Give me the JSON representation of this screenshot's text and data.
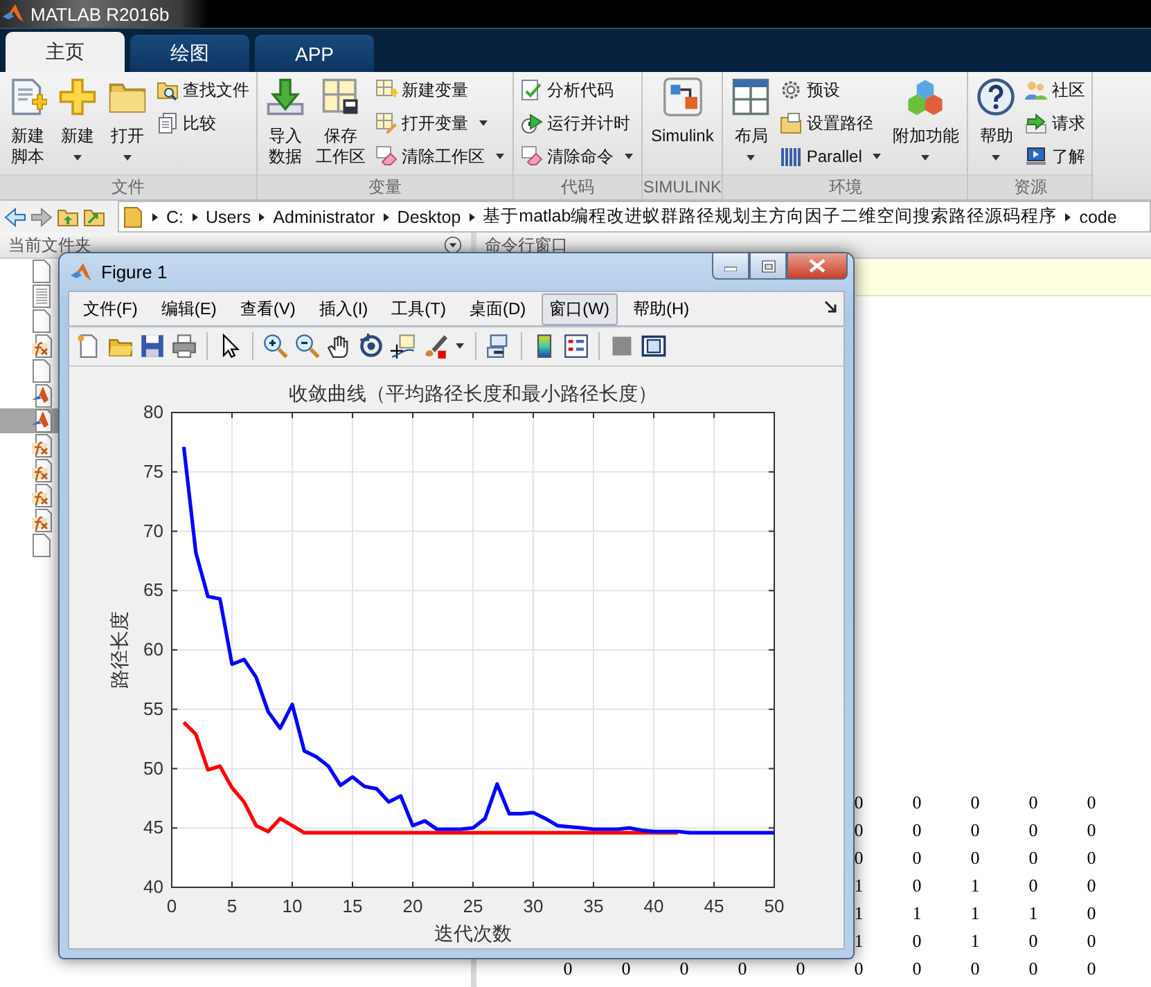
{
  "app_title": "MATLAB R2016b",
  "tabs": [
    {
      "label": "主页",
      "selected": true
    },
    {
      "label": "绘图",
      "selected": false
    },
    {
      "label": "APP",
      "selected": false
    }
  ],
  "toolstrip": {
    "sections": [
      {
        "label": "文件",
        "items": [
          {
            "kind": "big",
            "lines": [
              "新建",
              "脚本"
            ],
            "dropdown": false
          },
          {
            "kind": "big",
            "lines": [
              "新建"
            ],
            "dropdown": true
          },
          {
            "kind": "big",
            "lines": [
              "打开"
            ],
            "dropdown": true
          },
          {
            "kind": "small",
            "label": "查找文件",
            "dropdown": false
          },
          {
            "kind": "small",
            "label": "比较",
            "dropdown": false
          }
        ]
      },
      {
        "label": "变量",
        "items": [
          {
            "kind": "big",
            "lines": [
              "导入",
              "数据"
            ],
            "dropdown": false
          },
          {
            "kind": "big",
            "lines": [
              "保存",
              "工作区"
            ],
            "dropdown": false
          },
          {
            "kind": "small",
            "label": "新建变量",
            "dropdown": false
          },
          {
            "kind": "small",
            "label": "打开变量",
            "dropdown": true
          },
          {
            "kind": "small",
            "label": "清除工作区",
            "dropdown": true
          }
        ]
      },
      {
        "label": "代码",
        "items": [
          {
            "kind": "small",
            "label": "分析代码",
            "dropdown": false
          },
          {
            "kind": "small",
            "label": "运行并计时",
            "dropdown": false
          },
          {
            "kind": "small",
            "label": "清除命令",
            "dropdown": true
          }
        ]
      },
      {
        "label": "SIMULINK",
        "items": [
          {
            "kind": "big",
            "lines": [
              "Simulink"
            ],
            "dropdown": false
          }
        ]
      },
      {
        "label": "环境",
        "items": [
          {
            "kind": "big",
            "lines": [
              "布局"
            ],
            "dropdown": true
          },
          {
            "kind": "small",
            "label": "预设",
            "dropdown": false
          },
          {
            "kind": "small",
            "label": "设置路径",
            "dropdown": false
          },
          {
            "kind": "small",
            "label": "Parallel",
            "dropdown": true
          },
          {
            "kind": "big",
            "lines": [
              "附加功能"
            ],
            "dropdown": true
          }
        ]
      },
      {
        "label": "资源",
        "items": [
          {
            "kind": "big",
            "lines": [
              "帮助"
            ],
            "dropdown": true
          },
          {
            "kind": "small",
            "label": "社区",
            "dropdown": false
          },
          {
            "kind": "small",
            "label": "请求",
            "dropdown": false
          },
          {
            "kind": "small",
            "label": "了解",
            "dropdown": false
          }
        ]
      }
    ]
  },
  "address": {
    "segments": [
      "C:",
      "Users",
      "Administrator",
      "Desktop",
      "基于matlab编程改进蚁群路径规划主方向因子二维空间搜索路径源码程序",
      "code"
    ]
  },
  "files_panel": {
    "title": "当前文件夹",
    "files": [
      {
        "kind": "blank",
        "selected": false
      },
      {
        "kind": "text",
        "selected": false
      },
      {
        "kind": "blank",
        "selected": false
      },
      {
        "kind": "function",
        "selected": false
      },
      {
        "kind": "blank",
        "selected": false
      },
      {
        "kind": "app",
        "selected": false
      },
      {
        "kind": "app",
        "selected": true
      },
      {
        "kind": "function",
        "selected": false
      },
      {
        "kind": "function",
        "selected": false
      },
      {
        "kind": "function",
        "selected": false
      },
      {
        "kind": "function",
        "selected": false
      },
      {
        "kind": "blank",
        "selected": false
      }
    ]
  },
  "command_window": {
    "title": "命令行窗口",
    "matrix": [
      [
        "0",
        "0",
        "0",
        "0",
        "0"
      ],
      [
        "0",
        "0",
        "0",
        "0",
        "0"
      ],
      [
        "0",
        "0",
        "0",
        "0",
        "0"
      ],
      [
        "1",
        "0",
        "1",
        "0",
        "0"
      ],
      [
        "1",
        "1",
        "1",
        "1",
        "0"
      ],
      [
        "1",
        "0",
        "1",
        "0",
        "0"
      ],
      [
        "0",
        "0",
        "0",
        "0",
        "0",
        "0",
        "0",
        "0",
        "0",
        "0"
      ]
    ]
  },
  "figure": {
    "title": "Figure 1",
    "menus": [
      {
        "label": "文件(F)",
        "selected": false
      },
      {
        "label": "编辑(E)",
        "selected": false
      },
      {
        "label": "查看(V)",
        "selected": false
      },
      {
        "label": "插入(I)",
        "selected": false
      },
      {
        "label": "工具(T)",
        "selected": false
      },
      {
        "label": "桌面(D)",
        "selected": false
      },
      {
        "label": "窗口(W)",
        "selected": true
      },
      {
        "label": "帮助(H)",
        "selected": false
      }
    ],
    "chart_data": {
      "type": "line",
      "title": "收敛曲线（平均路径长度和最小路径长度）",
      "xlabel": "迭代次数",
      "ylabel": "路径长度",
      "x": [
        1,
        2,
        3,
        4,
        5,
        6,
        7,
        8,
        9,
        10,
        11,
        12,
        13,
        14,
        15,
        16,
        17,
        18,
        19,
        20,
        21,
        22,
        23,
        24,
        25,
        26,
        27,
        28,
        29,
        30,
        31,
        32,
        33,
        34,
        35,
        36,
        37,
        38,
        39,
        40,
        41,
        42,
        43,
        44,
        45,
        46,
        47,
        48,
        49,
        50
      ],
      "series": [
        {
          "color": "#0000ff",
          "values": [
            77.1,
            68.2,
            64.5,
            64.3,
            58.8,
            59.2,
            57.7,
            54.8,
            53.4,
            55.4,
            51.5,
            51.0,
            50.2,
            48.6,
            49.3,
            48.5,
            48.3,
            47.2,
            47.7,
            45.2,
            45.6,
            44.9,
            44.9,
            44.9,
            45.0,
            45.8,
            48.7,
            46.2,
            46.2,
            46.3,
            45.8,
            45.2,
            45.1,
            45.0,
            44.9,
            44.9,
            44.9,
            45.0,
            44.8,
            44.7,
            44.7,
            44.7,
            44.6,
            44.6,
            44.6,
            44.6,
            44.6,
            44.6,
            44.6,
            44.6
          ]
        },
        {
          "color": "#ff0000",
          "values": [
            53.9,
            52.9,
            49.9,
            50.2,
            48.4,
            47.2,
            45.2,
            44.7,
            45.8,
            45.2,
            44.6,
            44.6,
            44.6,
            44.6,
            44.6,
            44.6,
            44.6,
            44.6,
            44.6,
            44.6,
            44.6,
            44.6,
            44.6,
            44.6,
            44.6,
            44.6,
            44.6,
            44.6,
            44.6,
            44.6,
            44.6,
            44.6,
            44.6,
            44.6,
            44.6,
            44.6,
            44.6,
            44.6,
            44.6,
            44.6,
            44.6,
            44.6,
            null,
            null,
            null,
            null,
            null,
            null,
            null,
            null
          ]
        }
      ],
      "xlim": [
        0,
        50
      ],
      "ylim": [
        40,
        80
      ],
      "grid": true,
      "xticks": [
        0,
        5,
        10,
        15,
        20,
        25,
        30,
        35,
        40,
        45,
        50
      ],
      "yticks": [
        40,
        45,
        50,
        55,
        60,
        65,
        70,
        75,
        80
      ]
    }
  }
}
